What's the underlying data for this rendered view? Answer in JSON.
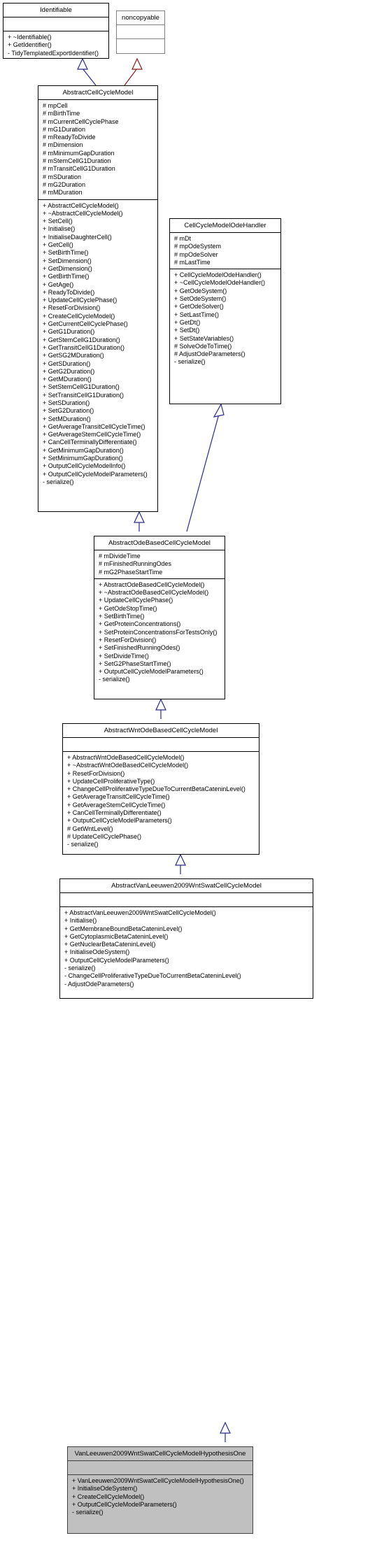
{
  "diagram": {
    "kind": "uml-class-inheritance",
    "title": "VanLeeuwen2009WntSwatCellCycleModelHypothesisOne inheritance diagram",
    "edge_color": "#2a2a8c",
    "highlight_fill": "#c0c0c0"
  },
  "classes": [
    {
      "id": "identifiable",
      "name": "Identifiable",
      "attributes": [],
      "methods": [
        "+ ~Identifiable()",
        "+ GetIdentifier()",
        "- TidyTemplatedExportIdentifier()"
      ]
    },
    {
      "id": "noncopyable",
      "name": "noncopyable",
      "attributes": [],
      "methods": []
    },
    {
      "id": "abstract-cell-cycle-model",
      "name": "AbstractCellCycleModel",
      "attributes": [
        "# mpCell",
        "# mBirthTime",
        "# mCurrentCellCyclePhase",
        "# mG1Duration",
        "# mReadyToDivide",
        "# mDimension",
        "# mMinimumGapDuration",
        "# mStemCellG1Duration",
        "# mTransitCellG1Duration",
        "# mSDuration",
        "# mG2Duration",
        "# mMDuration"
      ],
      "methods": [
        "+ AbstractCellCycleModel()",
        "+ ~AbstractCellCycleModel()",
        "+ SetCell()",
        "+ Initialise()",
        "+ InitialiseDaughterCell()",
        "+ GetCell()",
        "+ SetBirthTime()",
        "+ SetDimension()",
        "+ GetDimension()",
        "+ GetBirthTime()",
        "+ GetAge()",
        "+ ReadyToDivide()",
        "+ UpdateCellCyclePhase()",
        "+ ResetForDivision()",
        "+ CreateCellCycleModel()",
        "+ GetCurrentCellCyclePhase()",
        "+ GetG1Duration()",
        "+ GetStemCellG1Duration()",
        "+ GetTransitCellG1Duration()",
        "+ GetSG2MDuration()",
        "+ GetSDuration()",
        "+ GetG2Duration()",
        "+ GetMDuration()",
        "+ SetStemCellG1Duration()",
        "+ SetTransitCellG1Duration()",
        "+ SetSDuration()",
        "+ SetG2Duration()",
        "+ SetMDuration()",
        "+ GetAverageTransitCellCycleTime()",
        "+ GetAverageStemCellCycleTime()",
        "+ CanCellTerminallyDifferentiate()",
        "+ GetMinimumGapDuration()",
        "+ SetMinimumGapDuration()",
        "+ OutputCellCycleModelInfo()",
        "+ OutputCellCycleModelParameters()",
        "- serialize()"
      ]
    },
    {
      "id": "cell-cycle-model-ode-handler",
      "name": "CellCycleModelOdeHandler",
      "attributes": [
        "# mDt",
        "# mpOdeSystem",
        "# mpOdeSolver",
        "# mLastTime"
      ],
      "methods": [
        "+ CellCycleModelOdeHandler()",
        "+ ~CellCycleModelOdeHandler()",
        "+ GetOdeSystem()",
        "+ SetOdeSystem()",
        "+ GetOdeSolver()",
        "+ SetLastTime()",
        "+ GetDt()",
        "+ SetDt()",
        "+ SetStateVariables()",
        "# SolveOdeToTime()",
        "# AdjustOdeParameters()",
        "- serialize()"
      ]
    },
    {
      "id": "abstract-ode-based-cell-cycle-model",
      "name": "AbstractOdeBasedCellCycleModel",
      "attributes": [
        "# mDivideTime",
        "# mFinishedRunningOdes",
        "# mG2PhaseStartTime"
      ],
      "methods": [
        "+ AbstractOdeBasedCellCycleModel()",
        "+ ~AbstractOdeBasedCellCycleModel()",
        "+ UpdateCellCyclePhase()",
        "+ GetOdeStopTime()",
        "+ SetBirthTime()",
        "+ GetProteinConcentrations()",
        "+ SetProteinConcentrationsForTestsOnly()",
        "+ ResetForDivision()",
        "+ SetFinishedRunningOdes()",
        "+ SetDivideTime()",
        "+ SetG2PhaseStartTime()",
        "+ OutputCellCycleModelParameters()",
        "- serialize()"
      ]
    },
    {
      "id": "abstract-wnt-ode-based-cell-cycle-model",
      "name": "AbstractWntOdeBasedCellCycleModel",
      "attributes": [],
      "methods": [
        "+ AbstractWntOdeBasedCellCycleModel()",
        "+ ~AbstractWntOdeBasedCellCycleModel()",
        "+ ResetForDivision()",
        "+ UpdateCellProliferativeType()",
        "+ ChangeCellProliferativeTypeDueToCurrentBetaCateninLevel()",
        "+ GetAverageTransitCellCycleTime()",
        "+ GetAverageStemCellCycleTime()",
        "+ CanCellTerminallyDifferentiate()",
        "+ OutputCellCycleModelParameters()",
        "# GetWntLevel()",
        "# UpdateCellCyclePhase()",
        "- serialize()"
      ]
    },
    {
      "id": "abstract-van-leeuwen-2009-wnt-swat-cell-cycle-model",
      "name": "AbstractVanLeeuwen2009WntSwatCellCycleModel",
      "attributes": [],
      "methods": [
        "+ AbstractVanLeeuwen2009WntSwatCellCycleModel()",
        "+ Initialise()",
        "+ GetMembraneBoundBetaCateninLevel()",
        "+ GetCytoplasmicBetaCateninLevel()",
        "+ GetNuclearBetaCateninLevel()",
        "+ InitialiseOdeSystem()",
        "+ OutputCellCycleModelParameters()",
        "- serialize()",
        "- ChangeCellProliferativeTypeDueToCurrentBetaCateninLevel()",
        "- AdjustOdeParameters()"
      ]
    },
    {
      "id": "van-leeuwen-2009-wnt-swat-cell-cycle-model-hypothesis-one",
      "name": "VanLeeuwen2009WntSwatCellCycleModelHypothesisOne",
      "attributes": [],
      "methods": [
        "+ VanLeeuwen2009WntSwatCellCycleModelHypothesisOne()",
        "+ InitialiseOdeSystem()",
        "+ CreateCellCycleModel()",
        "+ OutputCellCycleModelParameters()",
        "- serialize()"
      ]
    }
  ],
  "edges": [
    {
      "from": "abstract-cell-cycle-model",
      "to": "identifiable",
      "type": "inheritance",
      "color": "#2a2a8c"
    },
    {
      "from": "abstract-cell-cycle-model",
      "to": "noncopyable",
      "type": "inheritance",
      "color": "#8c1a1a"
    },
    {
      "from": "abstract-ode-based-cell-cycle-model",
      "to": "abstract-cell-cycle-model",
      "type": "inheritance",
      "color": "#2a2a8c"
    },
    {
      "from": "abstract-ode-based-cell-cycle-model",
      "to": "cell-cycle-model-ode-handler",
      "type": "inheritance",
      "color": "#2a2a8c"
    },
    {
      "from": "abstract-wnt-ode-based-cell-cycle-model",
      "to": "abstract-ode-based-cell-cycle-model",
      "type": "inheritance",
      "color": "#2a2a8c"
    },
    {
      "from": "abstract-van-leeuwen-2009-wnt-swat-cell-cycle-model",
      "to": "abstract-wnt-ode-based-cell-cycle-model",
      "type": "inheritance",
      "color": "#2a2a8c"
    },
    {
      "from": "van-leeuwen-2009-wnt-swat-cell-cycle-model-hypothesis-one",
      "to": "abstract-van-leeuwen-2009-wnt-swat-cell-cycle-model",
      "type": "inheritance",
      "color": "#2a2a8c"
    }
  ]
}
